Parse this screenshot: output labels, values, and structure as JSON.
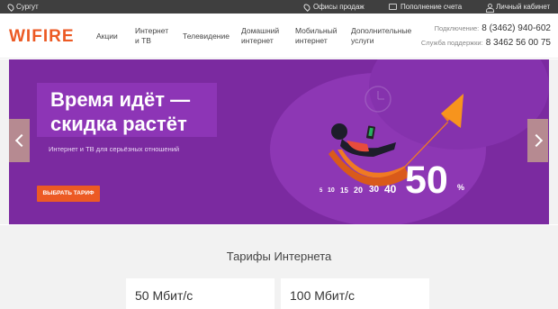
{
  "topbar": {
    "city": "Сургут",
    "offices": "Офисы продаж",
    "topup": "Пополнение счета",
    "cabinet": "Личный кабинет"
  },
  "header": {
    "logo": "WIFIRE",
    "nav": [
      {
        "line1": "Акции",
        "line2": ""
      },
      {
        "line1": "Интернет",
        "line2": "и ТВ"
      },
      {
        "line1": "Телевидение",
        "line2": ""
      },
      {
        "line1": "Домашний",
        "line2": "интернет"
      },
      {
        "line1": "Мобильный",
        "line2": "интернет"
      },
      {
        "line1": "Дополнительные",
        "line2": "услуги"
      }
    ],
    "connect_label": "Подключение:",
    "connect_phone": "8 (3462) 940-602",
    "support_label": "Служба поддержки:",
    "support_phone": "8 3462 56 00 75"
  },
  "banner": {
    "headline_line1": "Время идёт —",
    "headline_line2": "скидка растёт",
    "subtitle": "Интернет и ТВ для серьёзных отношений",
    "cta": "ВЫБРАТЬ ТАРИФ",
    "discount_steps": [
      "5",
      "10",
      "15",
      "20",
      "30",
      "40"
    ],
    "discount_big": "50",
    "discount_sign": "%"
  },
  "tariffs": {
    "title": "Тарифы Интернета",
    "cards": [
      "50 Мбит/с",
      "100 Мбит/с"
    ]
  },
  "colors": {
    "accent": "#ec5a24",
    "banner_bg": "#7b2aa0",
    "topbar_bg": "#3f3f3f"
  }
}
